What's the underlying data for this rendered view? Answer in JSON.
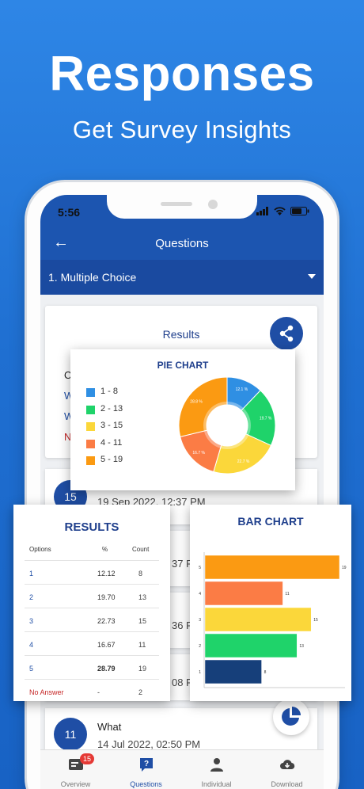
{
  "promo": {
    "headline": "Responses",
    "subheadline": "Get Survey Insights"
  },
  "status_bar": {
    "time": "5:56"
  },
  "app_bar": {
    "title": "Questions",
    "back_icon": "arrow-left-icon"
  },
  "question_select": {
    "selected": "1. Multiple Choice"
  },
  "results_card": {
    "title": "Results",
    "partial_lines": [
      "Op",
      "W",
      "W",
      "No"
    ]
  },
  "responses": [
    {
      "number": "15",
      "date": "19 Sep 2022, 12:37 PM"
    },
    {
      "number": "",
      "date": "37 P"
    },
    {
      "number": "",
      "date": "36 P"
    },
    {
      "number": "",
      "date": "08 P"
    },
    {
      "number": "11",
      "title": "What",
      "date": "14 Jul 2022, 02:50 PM"
    }
  ],
  "tabs": [
    {
      "label": "Overview",
      "icon": "overview-icon",
      "badge": "15"
    },
    {
      "label": "Questions",
      "icon": "questions-icon"
    },
    {
      "label": "Individual",
      "icon": "person-icon"
    },
    {
      "label": "Download",
      "icon": "download-cloud-icon"
    }
  ],
  "pie_chart": {
    "title": "PIE CHART",
    "legend": [
      "1 - 8",
      "2 - 13",
      "3 - 15",
      "4 - 11",
      "5 - 19"
    ],
    "slice_labels": [
      "12.1 %",
      "19.7 %",
      "22.7 %",
      "16.7 %",
      "28.8 %"
    ]
  },
  "results_table": {
    "title": "RESULTS",
    "headers": [
      "Options",
      "%",
      "Count"
    ],
    "rows": [
      {
        "option": "1",
        "pct": "12.12",
        "count": "8"
      },
      {
        "option": "2",
        "pct": "19.70",
        "count": "13"
      },
      {
        "option": "3",
        "pct": "22.73",
        "count": "15"
      },
      {
        "option": "4",
        "pct": "16.67",
        "count": "11"
      },
      {
        "option": "5",
        "pct": "28.79",
        "count": "19"
      },
      {
        "option": "No Answer",
        "pct": "-",
        "count": "2"
      }
    ]
  },
  "bar_chart": {
    "title": "BAR CHART"
  },
  "chart_data": [
    {
      "type": "pie",
      "title": "PIE CHART",
      "categories": [
        "1",
        "2",
        "3",
        "4",
        "5"
      ],
      "values": [
        8,
        13,
        15,
        11,
        19
      ],
      "percent_labels": [
        "12.1 %",
        "19.7 %",
        "22.7 %",
        "16.7 %",
        "28.8 %"
      ],
      "colors": [
        "#2f8fe3",
        "#1fd36a",
        "#fbd73a",
        "#fb7c45",
        "#fb9a12"
      ],
      "donut": true,
      "legend_placement": "left"
    },
    {
      "type": "bar",
      "orientation": "horizontal",
      "title": "BAR CHART",
      "categories": [
        "5",
        "4",
        "3",
        "2",
        "1"
      ],
      "values": [
        19,
        11,
        15,
        13,
        8
      ],
      "colors": [
        "#fb9a12",
        "#fb7c45",
        "#fbd73a",
        "#1fd36a",
        "#163f7a"
      ],
      "xlim": [
        0,
        19
      ]
    }
  ],
  "colors": {
    "primary": "#1c55b0",
    "accent": "#1f4ea5",
    "no_answer": "#c62828"
  }
}
